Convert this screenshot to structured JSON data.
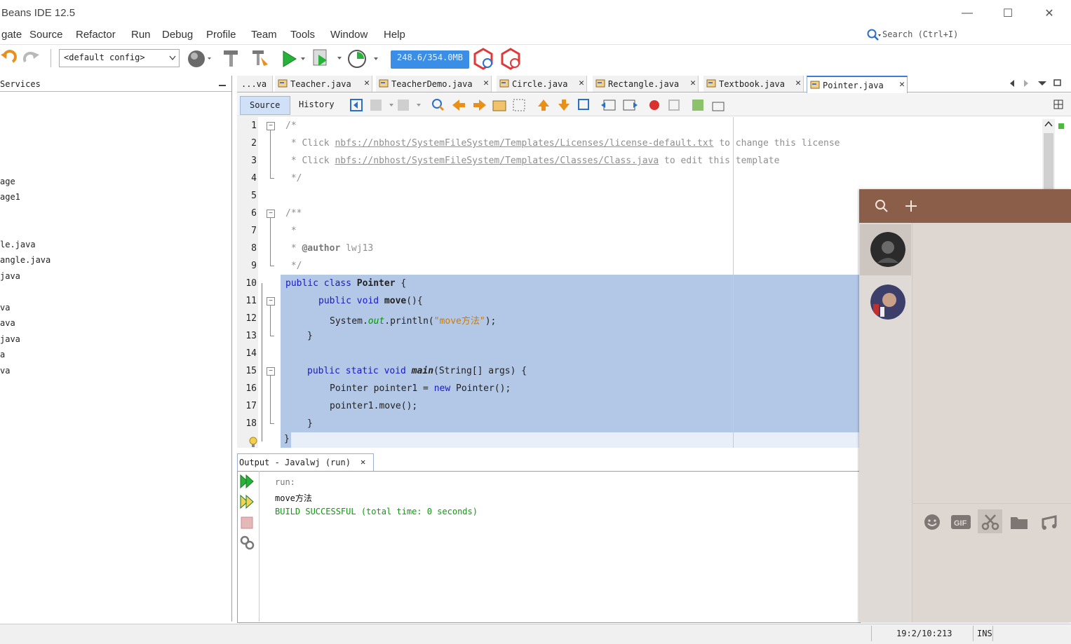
{
  "window": {
    "title": "Beans IDE 12.5",
    "minimize": "—",
    "maximize": "☐",
    "close": "✕"
  },
  "menu": [
    "gate",
    "Source",
    "Refactor",
    "Run",
    "Debug",
    "Profile",
    "Team",
    "Tools",
    "Window",
    "Help"
  ],
  "search": {
    "placeholder": "Search (Ctrl+I)"
  },
  "toolbar": {
    "config": "<default config>",
    "memory": "248.6/354.0MB"
  },
  "left_panel": {
    "tab": "Services",
    "items": [
      "age",
      "age1",
      "le.java",
      "angle.java",
      " java",
      "va",
      "ava",
      " java",
      "a",
      "va"
    ]
  },
  "editor_tabs": [
    {
      "label": "...va",
      "active": false
    },
    {
      "label": "Teacher.java",
      "active": false
    },
    {
      "label": "TeacherDemo.java",
      "active": false
    },
    {
      "label": "Circle.java",
      "active": false
    },
    {
      "label": "Rectangle.java",
      "active": false
    },
    {
      "label": "Textbook.java",
      "active": false
    },
    {
      "label": "Pointer.java",
      "active": true
    }
  ],
  "editor_toolbar": {
    "source": "Source",
    "history": "History"
  },
  "code": {
    "line_numbers": [
      "1",
      "2",
      "3",
      "4",
      "5",
      "6",
      "7",
      "8",
      "9",
      "10",
      "11",
      "12",
      "13",
      "14",
      "15",
      "16",
      "17",
      "18"
    ],
    "l1": "/*",
    "l2_pre": " * Click ",
    "l2_link": "nbfs://nbhost/SystemFileSystem/Templates/Licenses/license-default.txt",
    "l2_post": " to change this license",
    "l3_pre": " * Click ",
    "l3_link": "nbfs://nbhost/SystemFileSystem/Templates/Classes/Class.java",
    "l3_post": " to edit this template",
    "l4": " */",
    "l6": "/**",
    "l7": " *",
    "l8_pre": " * ",
    "l8_tag": "@author",
    "l8_name": " lwj13",
    "l9": " */",
    "l10_kw": "public class ",
    "l10_name": "Pointer",
    "l10_rest": " {",
    "l11_kw": "public void ",
    "l11_name": "move",
    "l11_rest": "(){",
    "l12_a": "System.",
    "l12_field": "out",
    "l12_b": ".println(",
    "l12_str": "\"move方法\"",
    "l12_c": ");",
    "l13": "}",
    "l15_kw": "public static void ",
    "l15_name": "main",
    "l15_rest": "(String[] args) {",
    "l16_a": "Pointer pointer1 = ",
    "l16_kw": "new",
    "l16_b": " Pointer();",
    "l17": "pointer1.move();",
    "l18": "}",
    "l19": "}"
  },
  "output": {
    "tab": "Output - Javalwj (run)",
    "lines": [
      "run:",
      "move方法",
      "BUILD SUCCESSFUL (total time: 0 seconds)"
    ]
  },
  "status": {
    "position": "19:2/10:213",
    "mode": "INS"
  },
  "colors": {
    "chat_header": "#8b5e49",
    "selection": "#b3c7e6",
    "memory_bar": "#3a8ee6"
  }
}
